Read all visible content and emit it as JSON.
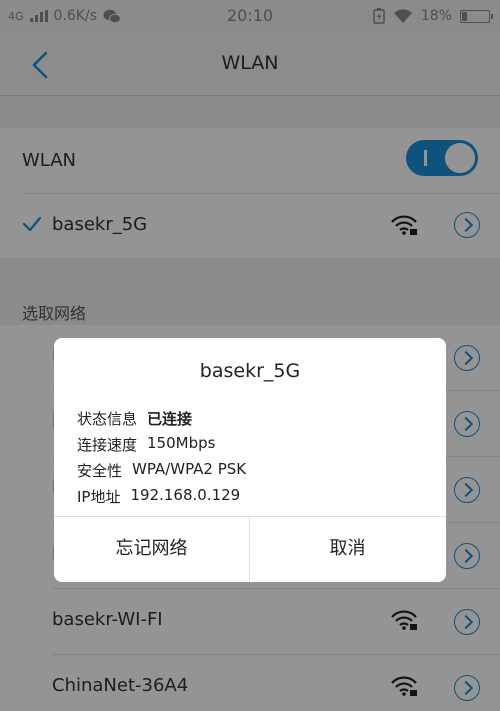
{
  "status_bar": {
    "network": "4G",
    "speed": "0.6K/s",
    "time": "20:10",
    "battery": "18%",
    "battery_level": 0.18
  },
  "header": {
    "title": "WLAN",
    "back_icon": "chevron-left-icon"
  },
  "wlan_toggle": {
    "label": "WLAN",
    "state": "on"
  },
  "connected_network": {
    "name": "basekr_5G",
    "icons": [
      "check-icon",
      "wifi-lock-icon",
      "chevron-right-circle-icon"
    ]
  },
  "available": {
    "section_label": "选取网络",
    "networks": [
      {
        "name": "i"
      },
      {
        "name": "l"
      },
      {
        "name": "l"
      },
      {
        "name": "l"
      },
      {
        "name": "basekr-WI-FI"
      },
      {
        "name": "ChinaNet-36A4"
      }
    ]
  },
  "dialog": {
    "title": "basekr_5G",
    "rows": [
      {
        "label": "状态信息",
        "value": "已连接"
      },
      {
        "label": "连接速度",
        "value": "150Mbps"
      },
      {
        "label": "安全性",
        "value": "WPA/WPA2 PSK"
      },
      {
        "label": "IP地址",
        "value": "192.168.0.129"
      }
    ],
    "forget_label": "忘记网络",
    "cancel_label": "取消"
  },
  "colors": {
    "accent": "#1a8dd8",
    "overlay": "rgba(0,0,0,0.42)"
  }
}
